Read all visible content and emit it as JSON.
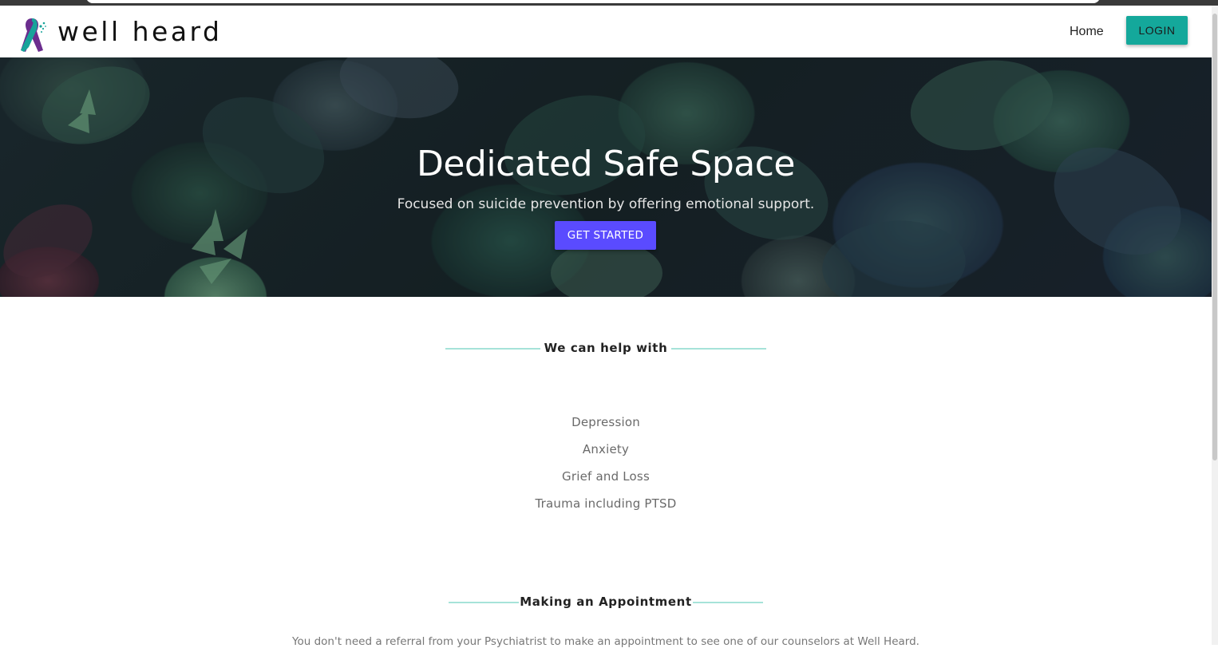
{
  "brand": {
    "name": "well heard",
    "logo_icon": "ribbon-icon",
    "colors": {
      "teal": "#14a89b",
      "purple": "#6b2d8e"
    }
  },
  "nav": {
    "home_label": "Home",
    "login_label": "LOGIN"
  },
  "hero": {
    "title": "Dedicated Safe Space",
    "subtitle": "Focused on suicide prevention by offering emotional support.",
    "cta_label": "GET STARTED",
    "cta_color": "#5a4bff"
  },
  "help_section": {
    "heading": "We can help with",
    "items": [
      "Depression",
      "Anxiety",
      "Grief and Loss",
      "Trauma including PTSD"
    ]
  },
  "appointment_section": {
    "heading": "Making an Appointment",
    "text": "You don't need a referral from your Psychiatrist to make an appointment to see one of our counselors at Well Heard."
  },
  "accent_line_color": "#a6e3d9"
}
